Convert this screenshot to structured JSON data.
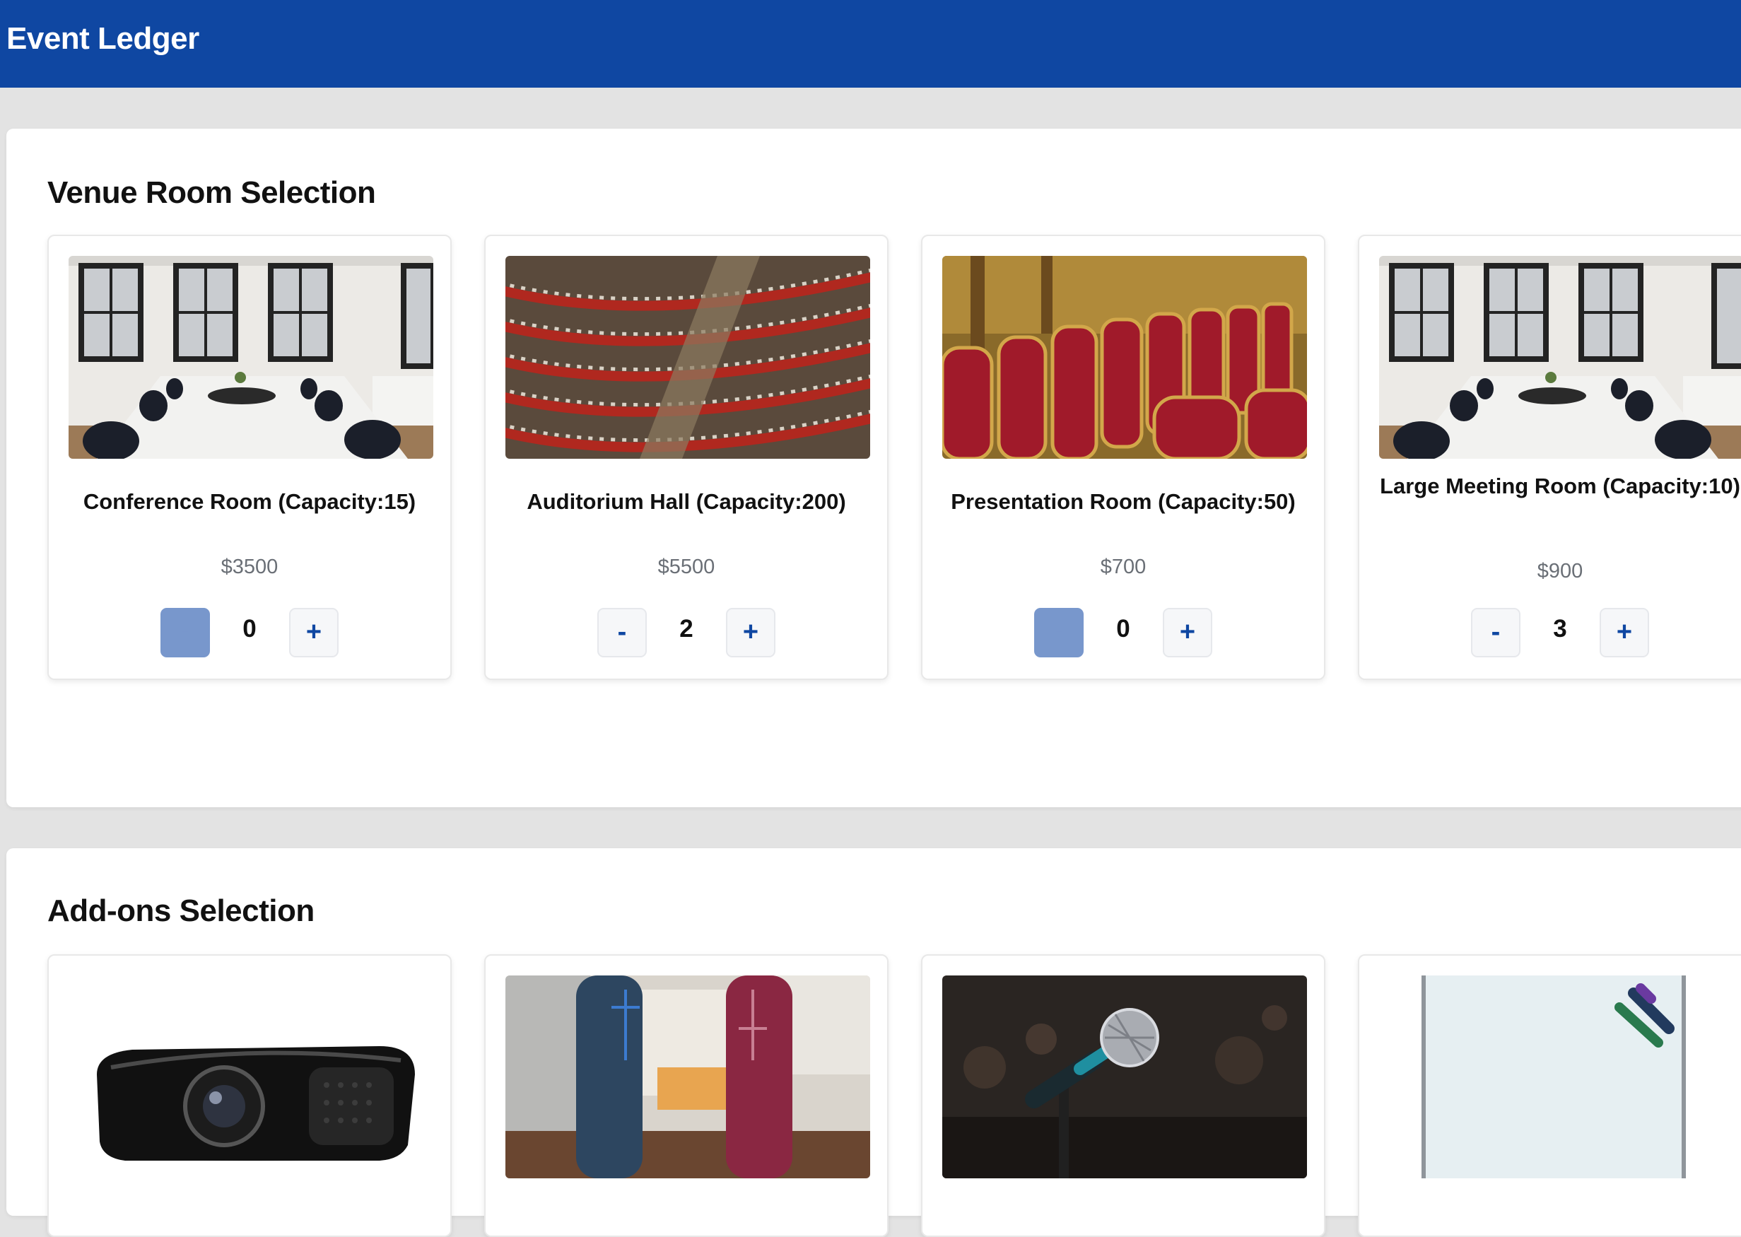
{
  "app": {
    "title": "Event Ledger"
  },
  "venue": {
    "title": "Venue Room Selection",
    "rooms": [
      {
        "name": "Conference Room (Capacity:15)",
        "price": "$3500",
        "quantity": "0",
        "minus_label": "-",
        "plus_label": "+",
        "minus_disabled": true
      },
      {
        "name": "Auditorium Hall (Capacity:200)",
        "price": "$5500",
        "quantity": "2",
        "minus_label": "-",
        "plus_label": "+",
        "minus_disabled": false
      },
      {
        "name": "Presentation Room (Capacity:50)",
        "price": "$700",
        "quantity": "0",
        "minus_label": "-",
        "plus_label": "+",
        "minus_disabled": true
      },
      {
        "name": "Large Meeting Room (Capacity:10)",
        "price": "$900",
        "quantity": "3",
        "minus_label": "-",
        "plus_label": "+",
        "minus_disabled": false
      }
    ]
  },
  "addons": {
    "title": "Add-ons Selection",
    "items": [
      {
        "image": "projector-photo"
      },
      {
        "image": "speakers-photo"
      },
      {
        "image": "microphone-photo"
      },
      {
        "image": "whiteboard-photo"
      }
    ]
  },
  "colors": {
    "header": "#0f47a2",
    "accent": "#0f47a2",
    "disabled_button": "#7897cc"
  }
}
